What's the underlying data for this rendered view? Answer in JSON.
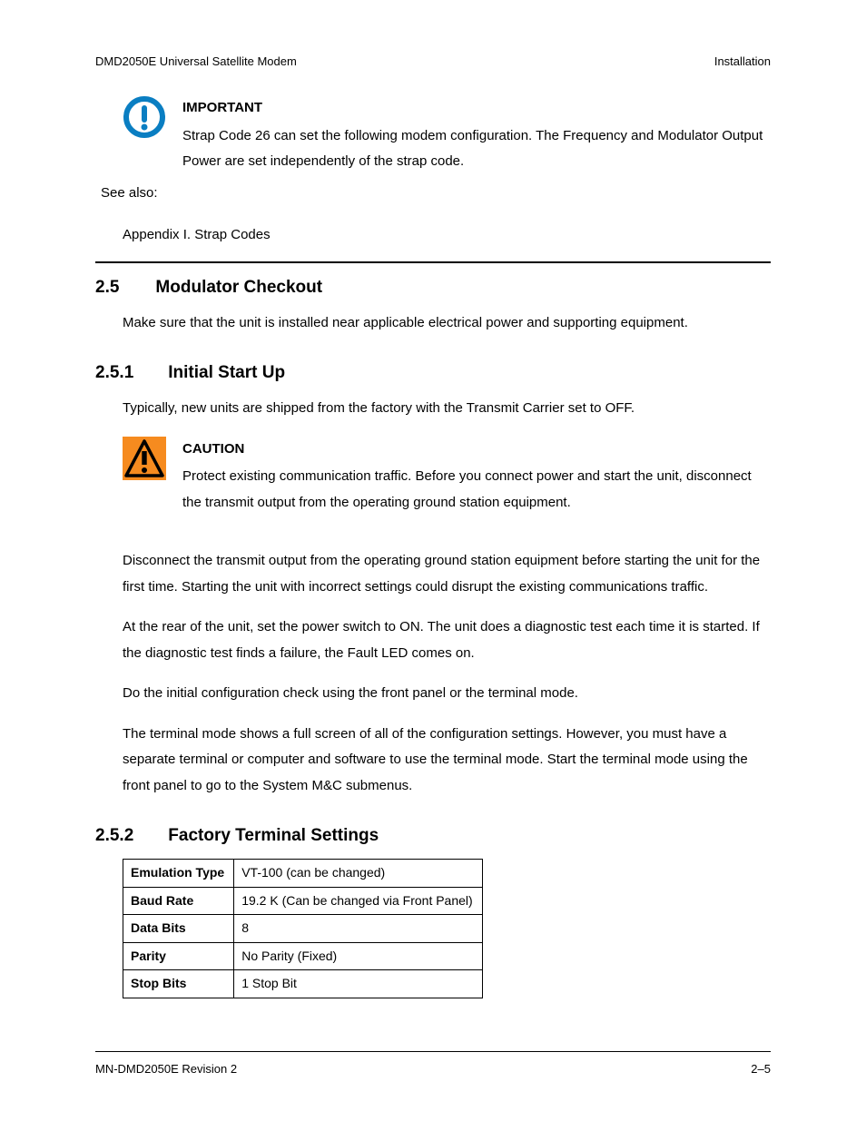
{
  "header": {
    "left": "DMD2050E Universal Satellite Modem",
    "right": "Installation"
  },
  "important": {
    "title": "IMPORTANT",
    "body": "Strap Code 26 can set the following modem configuration.  The Frequency and Modulator Output Power are set independently of the strap code."
  },
  "seeAlsoLabel": "See also:",
  "appendixRef": "Appendix I. Strap Codes",
  "sec25": {
    "num": "2.5",
    "title": "Modulator Checkout",
    "p1": "Make sure that the unit is installed near applicable electrical power and supporting equipment."
  },
  "sec251": {
    "num": "2.5.1",
    "title": "Initial Start Up",
    "p1": "Typically, new units are shipped from the factory with the Transmit Carrier set to OFF."
  },
  "caution": {
    "title": "CAUTION",
    "body": "Protect existing communication traffic. Before you connect power and start the unit, disconnect the transmit output from the operating ground station equipment."
  },
  "para": {
    "p2": "Disconnect the transmit output from the operating ground station equipment before starting the unit for the first time. Starting the unit with incorrect settings could disrupt the existing communications traffic.",
    "p3": "At the rear of the unit, set the power switch to ON. The unit does a diagnostic test each time it is started. If the diagnostic test finds a failure, the Fault LED comes on.",
    "p4": "Do the initial configuration check using the front panel or the terminal mode.",
    "p5": "The terminal mode shows a full screen of all of the configuration settings. However, you must have a separate terminal or computer  and software to use the terminal mode.  Start the terminal mode using the front panel to go to the System M&C submenus."
  },
  "sec252": {
    "num": "2.5.2",
    "title": "Factory Terminal Settings"
  },
  "table": {
    "rows": [
      {
        "label": "Emulation Type",
        "value": "VT-100 (can be changed)"
      },
      {
        "label": "Baud Rate",
        "value": "19.2 K (Can be changed via Front Panel)"
      },
      {
        "label": "Data Bits",
        "value": "8"
      },
      {
        "label": "Parity",
        "value": "No Parity (Fixed)"
      },
      {
        "label": "Stop Bits",
        "value": "1 Stop Bit"
      }
    ]
  },
  "footer": {
    "left": "MN-DMD2050E   Revision 2",
    "right": "2–5"
  }
}
